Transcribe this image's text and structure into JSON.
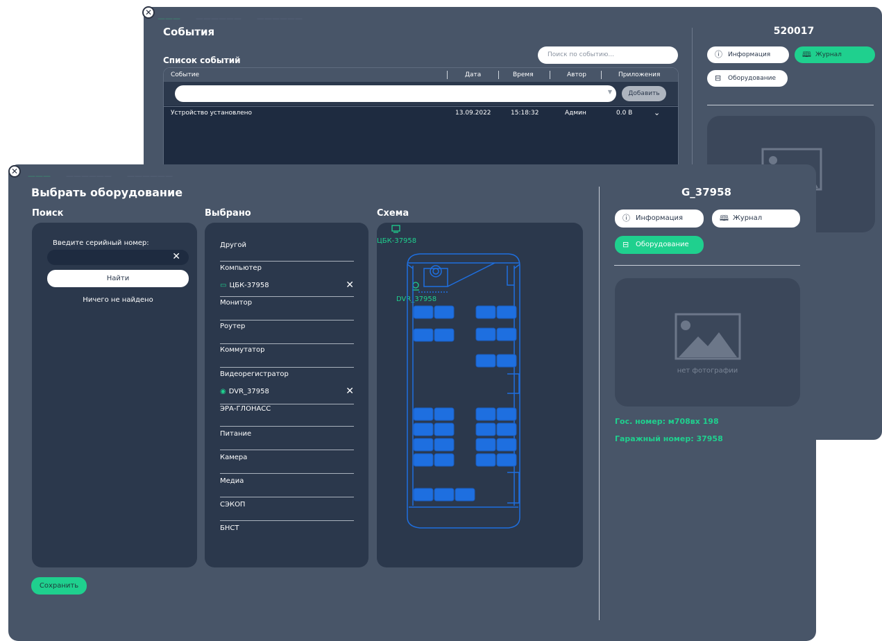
{
  "back_window": {
    "title": "События",
    "list_title": "Список событий",
    "search_placeholder": "Поиск по событию...",
    "columns": [
      "Событие",
      "Дата",
      "Время",
      "Автор",
      "Приложения"
    ],
    "add_label": "Добавить",
    "row": {
      "event": "Устройство установлено",
      "date": "13.09.2022",
      "time": "15:18:32",
      "author": "Админ",
      "attachments": "0.0 B"
    },
    "device_id": "520017",
    "buttons": {
      "info": "Информация",
      "journal": "Журнал",
      "equipment": "Оборудование"
    }
  },
  "front_window": {
    "title": "Выбрать оборудование",
    "columns": {
      "search": "Поиск",
      "selected": "Выбрано",
      "scheme": "Схема"
    },
    "search": {
      "label": "Введите серийный номер:",
      "find_label": "Найти",
      "not_found": "Ничего не найдено"
    },
    "categories": [
      {
        "label": "Другой",
        "items": []
      },
      {
        "label": "Компьютер",
        "items": [
          {
            "label": "ЦБК-37958",
            "icon": "monitor-icon"
          }
        ]
      },
      {
        "label": "Монитор",
        "items": []
      },
      {
        "label": "Роутер",
        "items": []
      },
      {
        "label": "Коммутатор",
        "items": []
      },
      {
        "label": "Видеорегистратор",
        "items": [
          {
            "label": "DVR_37958",
            "icon": "camera-icon"
          }
        ]
      },
      {
        "label": "ЭРА-ГЛОНАСС",
        "items": []
      },
      {
        "label": "Питание",
        "items": []
      },
      {
        "label": "Камера",
        "items": []
      },
      {
        "label": "Медиа",
        "items": []
      },
      {
        "label": "СЭКОП",
        "items": []
      },
      {
        "label": "БНСТ",
        "items": []
      }
    ],
    "scheme": {
      "computer_label": "ЦБК-37958",
      "dvr_label": "DVR_37958"
    },
    "device_id": "G_37958",
    "buttons": {
      "info": "Информация",
      "journal": "Журнал",
      "equipment": "Оборудование"
    },
    "no_photo": "нет фотографии",
    "gos_number": "Гос. номер: м708вх 198",
    "garage_number": "Гаражный номер: 37958",
    "save_label": "Сохранить"
  },
  "colors": {
    "accent": "#1fd08e",
    "scheme_blue": "#1e6fe0",
    "window_bg": "#485568",
    "panel_bg": "#2b384c"
  }
}
